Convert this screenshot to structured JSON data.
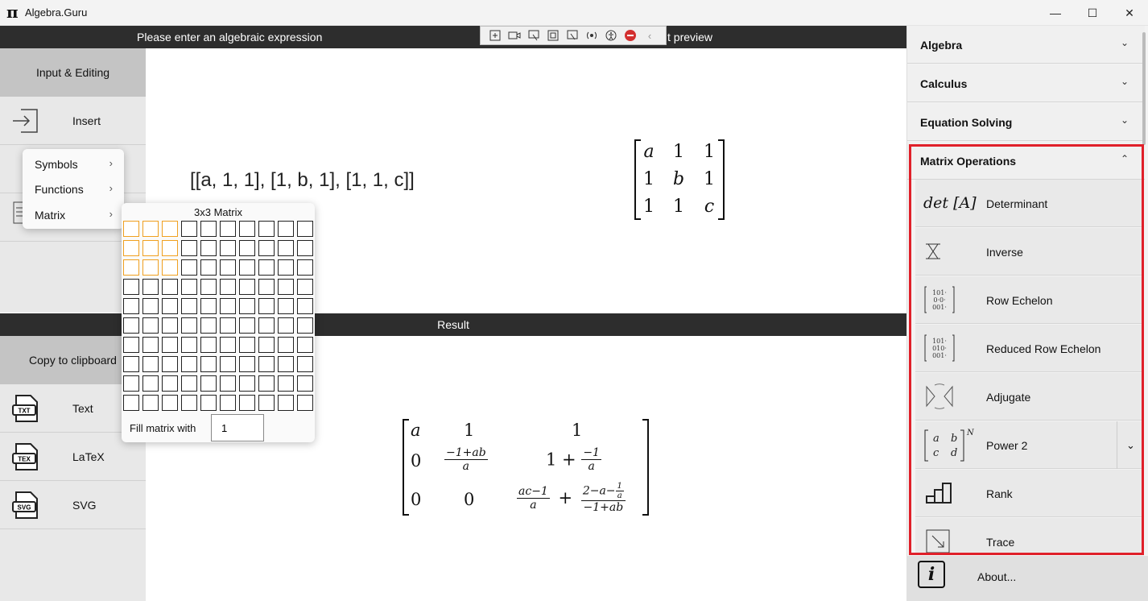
{
  "window": {
    "title": "Algebra.Guru",
    "minimize_glyph": "—",
    "maximize_glyph": "☐",
    "close_glyph": "✕"
  },
  "input_bar": {
    "prompt": "Please enter an algebraic expression",
    "preview_label": "t preview"
  },
  "left_panel": {
    "input_header": "Input & Editing",
    "insert_label": "Insert",
    "result_header": "Copy to clipboard",
    "copy_items": [
      {
        "label": "Text",
        "icon": "txt-file-icon",
        "tag": "TXT"
      },
      {
        "label": "LaTeX",
        "icon": "tex-file-icon",
        "tag": "TEX"
      },
      {
        "label": "SVG",
        "icon": "svg-file-icon",
        "tag": "SVG"
      }
    ]
  },
  "expression": {
    "text": "[[a, 1, 1], [1, b, 1], [1, 1, c]]",
    "preview_cells": [
      [
        "a",
        "1",
        "1"
      ],
      [
        "1",
        "b",
        "1"
      ],
      [
        "1",
        "1",
        "c"
      ]
    ]
  },
  "result": {
    "header": "Result",
    "cells": {
      "r1c1": "a",
      "r1c2": "1",
      "r1c3": "1",
      "r2c1": "0",
      "r2c2_num": "−1+ab",
      "r2c2_den": "a",
      "r2c3_whole": "1 +",
      "r2c3_num": "−1",
      "r2c3_den": "a",
      "r3c1": "0",
      "r3c2": "0",
      "r3c3_num1": "ac−1",
      "r3c3_den1": "a",
      "r3c3_plus": "+",
      "r3c3_num2": "2−a−",
      "r3c3_num2_frac_num": "1",
      "r3c3_num2_frac_den": "a",
      "r3c3_den2": "−1+ab"
    }
  },
  "context_menu": {
    "items": [
      {
        "label": "Symbols",
        "arrow": "›"
      },
      {
        "label": "Functions",
        "arrow": "›"
      },
      {
        "label": "Matrix",
        "arrow": "›"
      }
    ]
  },
  "matrix_picker": {
    "title": "3x3 Matrix",
    "rows": 10,
    "cols": 10,
    "selected_rows": 3,
    "selected_cols": 3,
    "fill_label": "Fill matrix with",
    "fill_value": "1",
    "highlight_color": "#f0a020"
  },
  "right_panel": {
    "sections": [
      {
        "label": "Algebra",
        "chevron": "⌄"
      },
      {
        "label": "Calculus",
        "chevron": "⌄"
      },
      {
        "label": "Equation Solving",
        "chevron": "⌄"
      },
      {
        "label": "Matrix Operations",
        "chevron": "⌃"
      }
    ],
    "operations": [
      {
        "label": "Determinant",
        "icon_text": "det [A]"
      },
      {
        "label": "Inverse",
        "icon_text": ""
      },
      {
        "label": "Row Echelon",
        "icon_text": ""
      },
      {
        "label": "Reduced Row Echelon",
        "icon_text": ""
      },
      {
        "label": "Adjugate",
        "icon_text": ""
      },
      {
        "label": "Power 2",
        "icon_text": "N"
      },
      {
        "label": "Rank",
        "icon_text": ""
      },
      {
        "label": "Trace",
        "icon_text": ""
      }
    ],
    "power_dropdown_glyph": "⌄",
    "about_label": "About...",
    "about_icon_text": "i",
    "highlight_color": "#e0202a"
  },
  "power_icon_cells": [
    "a",
    "b",
    "c",
    "d"
  ]
}
